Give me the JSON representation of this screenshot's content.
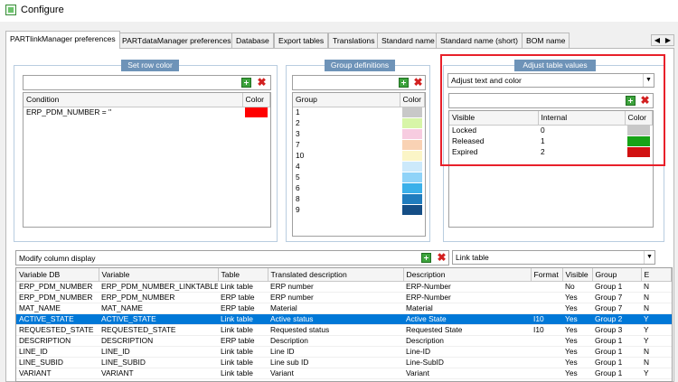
{
  "window": {
    "title": "Configure"
  },
  "tabs": [
    "PARTlinkManager preferences",
    "PARTdataManager preferences",
    "Database",
    "Export tables",
    "Translations",
    "Standard name",
    "Standard name (short)",
    "BOM name"
  ],
  "set_row_color": {
    "title": "Set row color",
    "headers": [
      "Condition",
      "Color"
    ],
    "rows": [
      {
        "condition": "ERP_PDM_NUMBER = ''",
        "color": "#ff0000"
      }
    ]
  },
  "group_definitions": {
    "title": "Group definitions",
    "headers": [
      "Group",
      "Color"
    ],
    "rows": [
      {
        "group": "1",
        "color": "#c8c8c8"
      },
      {
        "group": "2",
        "color": "#d7f5a8"
      },
      {
        "group": "3",
        "color": "#f7cce0"
      },
      {
        "group": "7",
        "color": "#f9d2b4"
      },
      {
        "group": "10",
        "color": "#fbf5c7"
      },
      {
        "group": "4",
        "color": "#cce9fb"
      },
      {
        "group": "5",
        "color": "#8fd3f8"
      },
      {
        "group": "6",
        "color": "#3ab0ea"
      },
      {
        "group": "8",
        "color": "#1f7cbe"
      },
      {
        "group": "9",
        "color": "#154e86"
      }
    ]
  },
  "adjust_table_values": {
    "title": "Adjust table values",
    "mode": "Adjust text and color",
    "headers": [
      "Visible",
      "Internal",
      "Color"
    ],
    "rows": [
      {
        "visible": "Locked",
        "internal": "0",
        "color": "#c8c8c8"
      },
      {
        "visible": "Released",
        "internal": "1",
        "color": "#17a317"
      },
      {
        "visible": "Expired",
        "internal": "2",
        "color": "#d11111"
      }
    ]
  },
  "modify_column_display": {
    "label": "Modify column display",
    "table_select": "Link table",
    "headers": [
      "Variable DB",
      "Variable",
      "Table",
      "Translated description",
      "Description",
      "Format",
      "Visible",
      "Group",
      "E"
    ],
    "rows": [
      [
        "ERP_PDM_NUMBER",
        "ERP_PDM_NUMBER_LINKTABLE",
        "Link table",
        "ERP number",
        "ERP-Number",
        "",
        "No",
        "Group 1",
        "N"
      ],
      [
        "ERP_PDM_NUMBER",
        "ERP_PDM_NUMBER",
        "ERP table",
        "ERP number",
        "ERP-Number",
        "",
        "Yes",
        "Group 7",
        "N"
      ],
      [
        "MAT_NAME",
        "MAT_NAME",
        "ERP table",
        "Material",
        "Material",
        "",
        "Yes",
        "Group 7",
        "N"
      ],
      [
        "ACTIVE_STATE",
        "ACTIVE_STATE",
        "Link table",
        "Active status",
        "Active State",
        "I10",
        "Yes",
        "Group 2",
        "Y"
      ],
      [
        "REQUESTED_STATE",
        "REQUESTED_STATE",
        "Link table",
        "Requested status",
        "Requested State",
        "I10",
        "Yes",
        "Group 3",
        "Y"
      ],
      [
        "DESCRIPTION",
        "DESCRIPTION",
        "ERP table",
        "Description",
        "Description",
        "",
        "Yes",
        "Group 1",
        "Y"
      ],
      [
        "LINE_ID",
        "LINE_ID",
        "Link table",
        "Line ID",
        "Line-ID",
        "",
        "Yes",
        "Group 1",
        "N"
      ],
      [
        "LINE_SUBID",
        "LINE_SUBID",
        "Link table",
        "Line sub ID",
        "Line-SubID",
        "",
        "Yes",
        "Group 1",
        "N"
      ],
      [
        "VARIANT",
        "VARIANT",
        "Link table",
        "Variant",
        "Variant",
        "",
        "Yes",
        "Group 1",
        "Y"
      ]
    ],
    "selected_row": 3
  }
}
